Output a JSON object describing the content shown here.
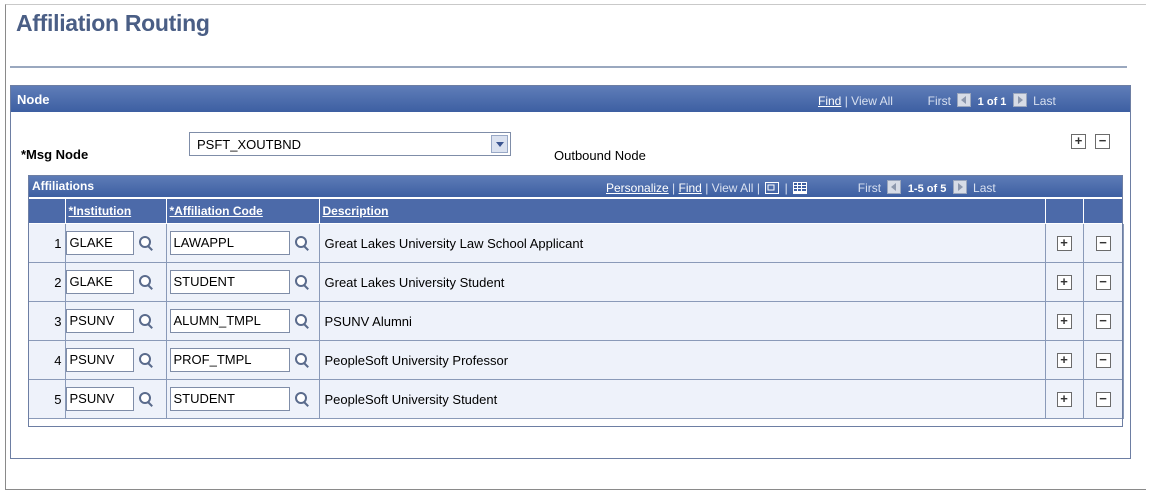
{
  "page": {
    "title": "Affiliation Routing"
  },
  "node": {
    "header": "Node",
    "nav": {
      "find": "Find",
      "sep": "|",
      "view_all": "View All",
      "first": "First",
      "range": "1 of 1",
      "last": "Last"
    },
    "msg_label": "*Msg Node",
    "msg_value": "PSFT_XOUTBND",
    "msg_desc": "Outbound Node",
    "add_label": "+",
    "remove_label": "−"
  },
  "affiliations": {
    "header": "Affiliations",
    "nav": {
      "personalize": "Personalize",
      "sep": "|",
      "find": "Find",
      "view_all": "View All",
      "first": "First",
      "range": "1-5 of 5",
      "last": "Last"
    },
    "columns": {
      "institution": "*Institution",
      "affiliation_code": "*Affiliation Code",
      "description": "Description"
    },
    "rows": [
      {
        "num": "1",
        "institution": "GLAKE",
        "code": "LAWAPPL",
        "description": "Great Lakes University Law School Applicant"
      },
      {
        "num": "2",
        "institution": "GLAKE",
        "code": "STUDENT",
        "description": "Great Lakes University Student"
      },
      {
        "num": "3",
        "institution": "PSUNV",
        "code": "ALUMN_TMPL",
        "description": "PSUNV Alumni"
      },
      {
        "num": "4",
        "institution": "PSUNV",
        "code": "PROF_TMPL",
        "description": "PeopleSoft University Professor"
      },
      {
        "num": "5",
        "institution": "PSUNV",
        "code": "STUDENT",
        "description": "PeopleSoft University Student"
      }
    ],
    "add_label": "+",
    "remove_label": "−"
  }
}
